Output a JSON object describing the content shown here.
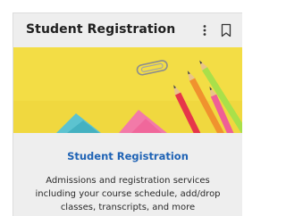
{
  "card": {
    "header_title": "Student Registration",
    "menu_icon": "more-vert-icon",
    "bookmark_icon": "bookmark-outline-icon",
    "image_alt": "Yellow desk with colored pencils, paper clip and sticky notes",
    "body_title": "Student Registration",
    "description": "Admissions and registration services including your course schedule, add/drop classes, transcripts, and more"
  },
  "colors": {
    "card_background": "#eeeeee",
    "link_blue": "#1f63b5",
    "hero_yellow": "#f3dd45"
  }
}
